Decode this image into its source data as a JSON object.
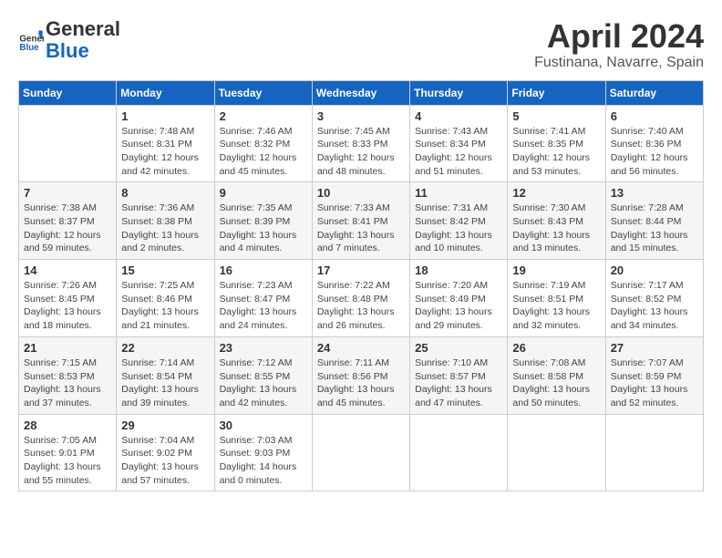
{
  "header": {
    "logo_line1": "General",
    "logo_line2": "Blue",
    "title": "April 2024",
    "subtitle": "Fustinana, Navarre, Spain"
  },
  "calendar": {
    "weekdays": [
      "Sunday",
      "Monday",
      "Tuesday",
      "Wednesday",
      "Thursday",
      "Friday",
      "Saturday"
    ],
    "weeks": [
      [
        {
          "day": "",
          "info": ""
        },
        {
          "day": "1",
          "info": "Sunrise: 7:48 AM\nSunset: 8:31 PM\nDaylight: 12 hours\nand 42 minutes."
        },
        {
          "day": "2",
          "info": "Sunrise: 7:46 AM\nSunset: 8:32 PM\nDaylight: 12 hours\nand 45 minutes."
        },
        {
          "day": "3",
          "info": "Sunrise: 7:45 AM\nSunset: 8:33 PM\nDaylight: 12 hours\nand 48 minutes."
        },
        {
          "day": "4",
          "info": "Sunrise: 7:43 AM\nSunset: 8:34 PM\nDaylight: 12 hours\nand 51 minutes."
        },
        {
          "day": "5",
          "info": "Sunrise: 7:41 AM\nSunset: 8:35 PM\nDaylight: 12 hours\nand 53 minutes."
        },
        {
          "day": "6",
          "info": "Sunrise: 7:40 AM\nSunset: 8:36 PM\nDaylight: 12 hours\nand 56 minutes."
        }
      ],
      [
        {
          "day": "7",
          "info": "Sunrise: 7:38 AM\nSunset: 8:37 PM\nDaylight: 12 hours\nand 59 minutes."
        },
        {
          "day": "8",
          "info": "Sunrise: 7:36 AM\nSunset: 8:38 PM\nDaylight: 13 hours\nand 2 minutes."
        },
        {
          "day": "9",
          "info": "Sunrise: 7:35 AM\nSunset: 8:39 PM\nDaylight: 13 hours\nand 4 minutes."
        },
        {
          "day": "10",
          "info": "Sunrise: 7:33 AM\nSunset: 8:41 PM\nDaylight: 13 hours\nand 7 minutes."
        },
        {
          "day": "11",
          "info": "Sunrise: 7:31 AM\nSunset: 8:42 PM\nDaylight: 13 hours\nand 10 minutes."
        },
        {
          "day": "12",
          "info": "Sunrise: 7:30 AM\nSunset: 8:43 PM\nDaylight: 13 hours\nand 13 minutes."
        },
        {
          "day": "13",
          "info": "Sunrise: 7:28 AM\nSunset: 8:44 PM\nDaylight: 13 hours\nand 15 minutes."
        }
      ],
      [
        {
          "day": "14",
          "info": "Sunrise: 7:26 AM\nSunset: 8:45 PM\nDaylight: 13 hours\nand 18 minutes."
        },
        {
          "day": "15",
          "info": "Sunrise: 7:25 AM\nSunset: 8:46 PM\nDaylight: 13 hours\nand 21 minutes."
        },
        {
          "day": "16",
          "info": "Sunrise: 7:23 AM\nSunset: 8:47 PM\nDaylight: 13 hours\nand 24 minutes."
        },
        {
          "day": "17",
          "info": "Sunrise: 7:22 AM\nSunset: 8:48 PM\nDaylight: 13 hours\nand 26 minutes."
        },
        {
          "day": "18",
          "info": "Sunrise: 7:20 AM\nSunset: 8:49 PM\nDaylight: 13 hours\nand 29 minutes."
        },
        {
          "day": "19",
          "info": "Sunrise: 7:19 AM\nSunset: 8:51 PM\nDaylight: 13 hours\nand 32 minutes."
        },
        {
          "day": "20",
          "info": "Sunrise: 7:17 AM\nSunset: 8:52 PM\nDaylight: 13 hours\nand 34 minutes."
        }
      ],
      [
        {
          "day": "21",
          "info": "Sunrise: 7:15 AM\nSunset: 8:53 PM\nDaylight: 13 hours\nand 37 minutes."
        },
        {
          "day": "22",
          "info": "Sunrise: 7:14 AM\nSunset: 8:54 PM\nDaylight: 13 hours\nand 39 minutes."
        },
        {
          "day": "23",
          "info": "Sunrise: 7:12 AM\nSunset: 8:55 PM\nDaylight: 13 hours\nand 42 minutes."
        },
        {
          "day": "24",
          "info": "Sunrise: 7:11 AM\nSunset: 8:56 PM\nDaylight: 13 hours\nand 45 minutes."
        },
        {
          "day": "25",
          "info": "Sunrise: 7:10 AM\nSunset: 8:57 PM\nDaylight: 13 hours\nand 47 minutes."
        },
        {
          "day": "26",
          "info": "Sunrise: 7:08 AM\nSunset: 8:58 PM\nDaylight: 13 hours\nand 50 minutes."
        },
        {
          "day": "27",
          "info": "Sunrise: 7:07 AM\nSunset: 8:59 PM\nDaylight: 13 hours\nand 52 minutes."
        }
      ],
      [
        {
          "day": "28",
          "info": "Sunrise: 7:05 AM\nSunset: 9:01 PM\nDaylight: 13 hours\nand 55 minutes."
        },
        {
          "day": "29",
          "info": "Sunrise: 7:04 AM\nSunset: 9:02 PM\nDaylight: 13 hours\nand 57 minutes."
        },
        {
          "day": "30",
          "info": "Sunrise: 7:03 AM\nSunset: 9:03 PM\nDaylight: 14 hours\nand 0 minutes."
        },
        {
          "day": "",
          "info": ""
        },
        {
          "day": "",
          "info": ""
        },
        {
          "day": "",
          "info": ""
        },
        {
          "day": "",
          "info": ""
        }
      ]
    ]
  }
}
